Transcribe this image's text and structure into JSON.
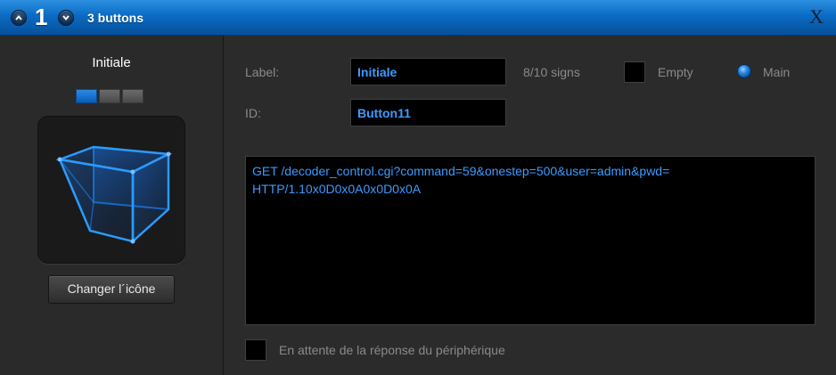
{
  "titlebar": {
    "page_number": "1",
    "title": "3 buttons",
    "close_label": "X",
    "prev_icon": "chevron-up-icon",
    "next_icon": "chevron-down-icon",
    "accent_color": "#0b6bc4"
  },
  "left": {
    "button_name": "Initiale",
    "page_indicator": {
      "total": 3,
      "active": 1
    },
    "icon": "3d-cube-icon",
    "change_icon_label": "Changer l´icône"
  },
  "form": {
    "label_caption": "Label:",
    "label_value": "Initiale",
    "counter": "8/10 signs",
    "empty_label": "Empty",
    "empty_checked": false,
    "main_label": "Main",
    "main_selected": true,
    "id_caption": "ID:",
    "id_value": "Button11"
  },
  "command": {
    "lines": [
      "GET /decoder_control.cgi?command=59&onestep=500&user=admin&pwd=",
      "HTTP/1.10x0D0x0A0x0D0x0A"
    ]
  },
  "wait_response": {
    "label": "En attente de la réponse du périphérique",
    "checked": false
  }
}
